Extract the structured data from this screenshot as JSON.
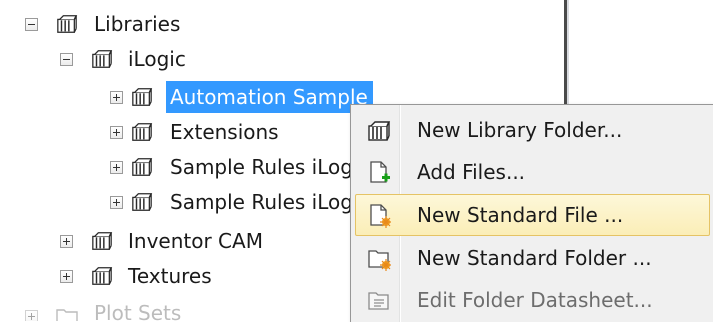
{
  "tree": {
    "libraries": {
      "label": "Libraries",
      "expanded": true
    },
    "ilogic": {
      "label": "iLogic",
      "expanded": true
    },
    "children": [
      {
        "label": "Automation Sample",
        "selected": true
      },
      {
        "label": "Extensions"
      },
      {
        "label": "Sample Rules iLog"
      },
      {
        "label": "Sample Rules iLog"
      }
    ],
    "inventor_cam": {
      "label": "Inventor CAM"
    },
    "textures": {
      "label": "Textures"
    },
    "plot_sets": {
      "label": "Plot Sets"
    }
  },
  "context_menu": {
    "items": [
      {
        "label": "New Library Folder...",
        "icon": "library-folder-icon"
      },
      {
        "label": "Add Files...",
        "icon": "add-file-icon"
      },
      {
        "label": "New Standard File ...",
        "icon": "new-standard-file-icon",
        "hover": true
      },
      {
        "label": "New Standard Folder ...",
        "icon": "new-standard-folder-icon"
      },
      {
        "label": "Edit Folder Datasheet...",
        "icon": "folder-datasheet-icon",
        "disabled": true
      }
    ]
  },
  "colors": {
    "selection": "#3399ff",
    "menu_hover": "#fbeeb7",
    "menu_hover_border": "#e5c365"
  }
}
